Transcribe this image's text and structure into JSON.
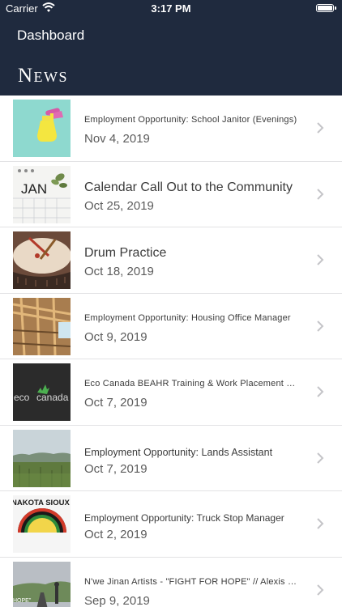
{
  "status_bar": {
    "carrier": "Carrier",
    "time": "3:17 PM"
  },
  "nav": {
    "back_title": "Dashboard",
    "page_title": "News"
  },
  "news": [
    {
      "title": "Employment Opportunity: School Janitor (Evenings)",
      "date": "Nov 4, 2019",
      "style": "small",
      "thumb_icon": "spray-bottle-image"
    },
    {
      "title": "Calendar Call Out to the Community",
      "date": "Oct 25, 2019",
      "style": "large",
      "thumb_icon": "calendar-image"
    },
    {
      "title": "Drum Practice",
      "date": "Oct 18, 2019",
      "style": "large",
      "thumb_icon": "drum-image"
    },
    {
      "title": "Employment Opportunity: Housing Office Manager",
      "date": "Oct 9, 2019",
      "style": "small",
      "thumb_icon": "construction-image"
    },
    {
      "title": "Eco Canada BEAHR Training & Work Placement Opportunity",
      "date": "Oct 7, 2019",
      "style": "small",
      "thumb_icon": "eco-canada-logo"
    },
    {
      "title": "Employment Opportunity: Lands Assistant",
      "date": "Oct 7, 2019",
      "style": "medium",
      "thumb_icon": "landscape-image"
    },
    {
      "title": "Employment Opportunity: Truck Stop Manager",
      "date": "Oct 2, 2019",
      "style": "medium",
      "thumb_icon": "nakota-sioux-logo"
    },
    {
      "title": "N'we Jinan Artists - \"FIGHT FOR HOPE\" // Alexis Nakota Sioux Nation",
      "date": "Sep 9, 2019",
      "style": "small",
      "thumb_icon": "road-image"
    }
  ],
  "thumb_text": {
    "calendar": "JAN",
    "eco_left": "eco",
    "eco_right": "canada",
    "nakota": "NAKOTA SIOUX",
    "road": "HOPE\""
  },
  "colors": {
    "nav_background": "#1f2a3e",
    "separator": "#e2e2e4",
    "chevron": "#c4c4c8"
  }
}
